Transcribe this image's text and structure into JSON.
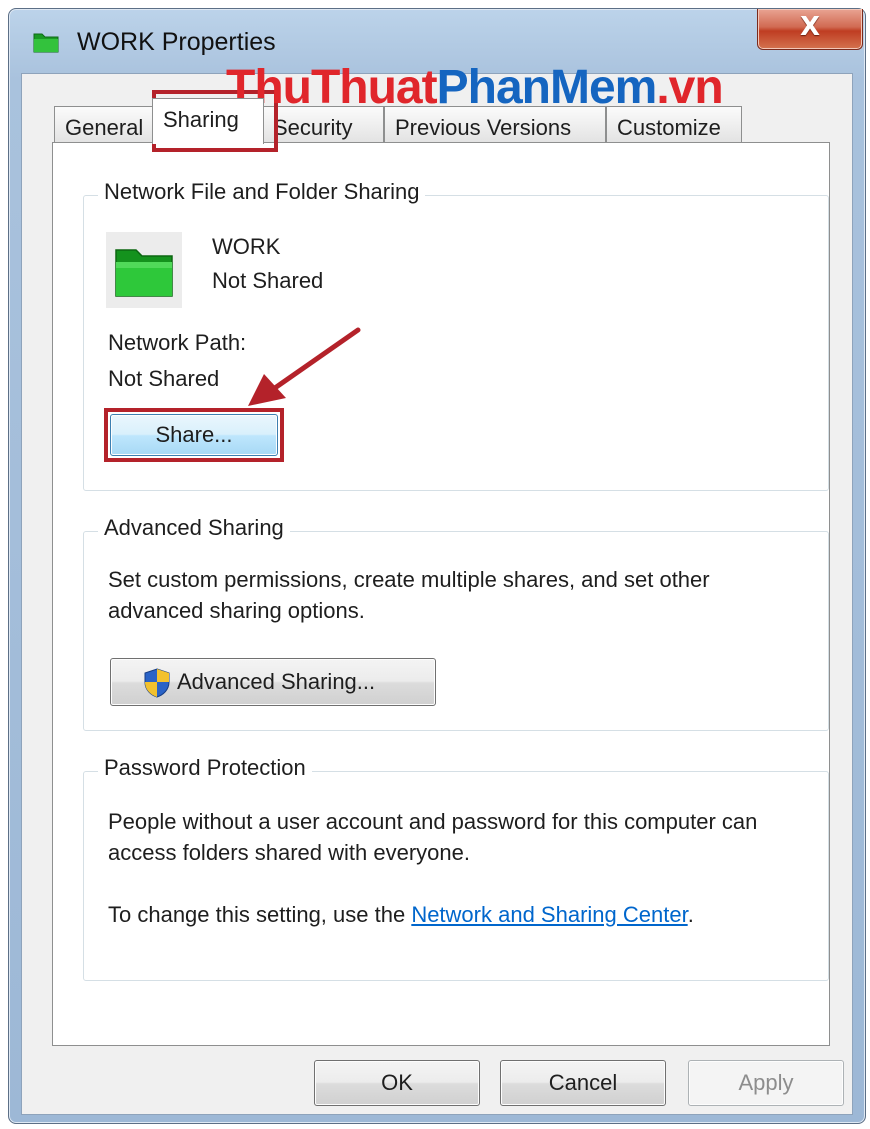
{
  "window": {
    "title": "WORK Properties",
    "close_symbol": "X"
  },
  "tabs": [
    {
      "label": "General",
      "active": false
    },
    {
      "label": "Sharing",
      "active": true
    },
    {
      "label": "Security",
      "active": false
    },
    {
      "label": "Previous Versions",
      "active": false
    },
    {
      "label": "Customize",
      "active": false
    }
  ],
  "network_sharing": {
    "group_title": "Network File and Folder Sharing",
    "folder_name": "WORK",
    "folder_status": "Not Shared",
    "path_label": "Network Path:",
    "path_value": "Not Shared",
    "share_button": "Share..."
  },
  "advanced_sharing": {
    "group_title": "Advanced Sharing",
    "description": "Set custom permissions, create multiple shares, and set other advanced sharing options.",
    "button": "Advanced Sharing..."
  },
  "password_protection": {
    "group_title": "Password Protection",
    "description": "People without a user account and password for this computer can access folders shared with everyone.",
    "change_prefix": "To change this setting, use the ",
    "change_link": "Network and Sharing Center",
    "change_suffix": "."
  },
  "footer": {
    "ok": "OK",
    "cancel": "Cancel",
    "apply": "Apply"
  },
  "watermark": {
    "part1": "ThuThuat",
    "part2": "PhanMem",
    "part3": ".vn"
  },
  "colors": {
    "folder_green": "#21b02b",
    "highlight_red": "#b4222a",
    "link_blue": "#0066cc"
  },
  "icons": {
    "title_icon": "folder-icon",
    "share_folder_icon": "folder-icon",
    "advanced_button_icon": "uac-shield-icon"
  }
}
